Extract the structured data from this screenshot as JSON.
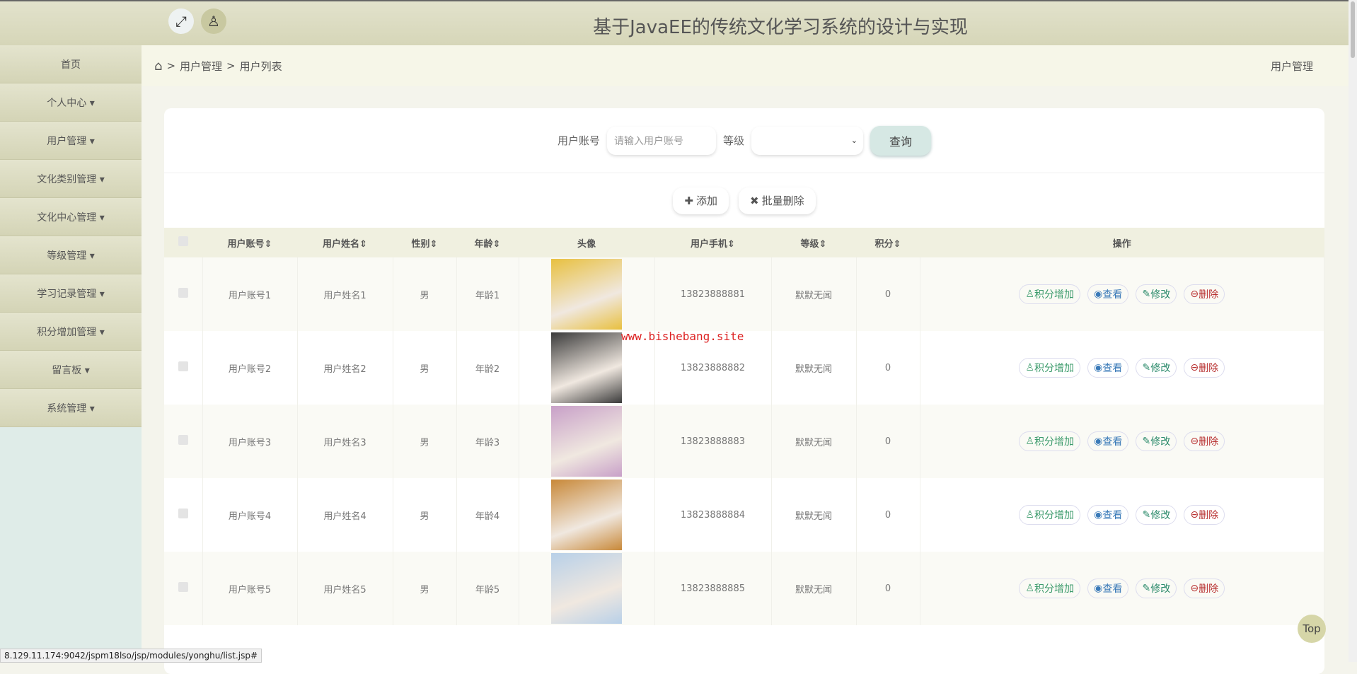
{
  "header": {
    "title": "基于JavaEE的传统文化学习系统的设计与实现"
  },
  "sidebar": {
    "items": [
      {
        "label": "首页"
      },
      {
        "label": "个人中心 ▾"
      },
      {
        "label": "用户管理 ▾"
      },
      {
        "label": "文化类别管理 ▾"
      },
      {
        "label": "文化中心管理 ▾"
      },
      {
        "label": "等级管理 ▾"
      },
      {
        "label": "学习记录管理 ▾"
      },
      {
        "label": "积分增加管理 ▾"
      },
      {
        "label": "留言板 ▾"
      },
      {
        "label": "系统管理 ▾"
      }
    ]
  },
  "breadcrumb": {
    "sep1": ">",
    "item1": "用户管理",
    "sep2": ">",
    "item2": "用户列表",
    "right": "用户管理"
  },
  "search": {
    "account_label": "用户账号",
    "account_placeholder": "请输入用户账号",
    "level_label": "等级",
    "level_value": "",
    "query": "查询"
  },
  "actions": {
    "add": "添加",
    "batch_delete": "批量删除"
  },
  "table": {
    "headers": [
      "用户账号⇕",
      "用户姓名⇕",
      "性别⇕",
      "年龄⇕",
      "头像",
      "用户手机⇕",
      "等级⇕",
      "积分⇕",
      "操作"
    ],
    "rows": [
      {
        "account": "用户账号1",
        "name": "用户姓名1",
        "gender": "男",
        "age": "年龄1",
        "phone": "13823888881",
        "level": "默默无闻",
        "points": "0",
        "avatar_color": "#e8c040"
      },
      {
        "account": "用户账号2",
        "name": "用户姓名2",
        "gender": "男",
        "age": "年龄2",
        "phone": "13823888882",
        "level": "默默无闻",
        "points": "0",
        "avatar_color": "#3a3a3a"
      },
      {
        "account": "用户账号3",
        "name": "用户姓名3",
        "gender": "男",
        "age": "年龄3",
        "phone": "13823888883",
        "level": "默默无闻",
        "points": "0",
        "avatar_color": "#c8a0c8"
      },
      {
        "account": "用户账号4",
        "name": "用户姓名4",
        "gender": "男",
        "age": "年龄4",
        "phone": "13823888884",
        "level": "默默无闻",
        "points": "0",
        "avatar_color": "#c88838"
      },
      {
        "account": "用户账号5",
        "name": "用户姓名5",
        "gender": "男",
        "age": "年龄5",
        "phone": "13823888885",
        "level": "默默无闻",
        "points": "0",
        "avatar_color": "#b8d0e8"
      }
    ],
    "ops": {
      "points": "积分增加",
      "view": "查看",
      "edit": "修改",
      "delete": "删除"
    }
  },
  "watermark": "www.bishebang.site",
  "status_url": "8.129.11.174:9042/jspm18lso/jsp/modules/yonghu/list.jsp#",
  "top_button": "Top"
}
